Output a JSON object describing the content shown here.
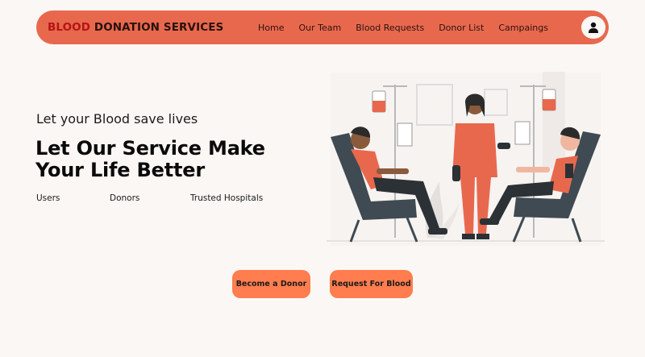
{
  "brand": {
    "part1": "BLOOD",
    "part2": "DONATION SERVICES"
  },
  "nav": {
    "items": [
      {
        "label": "Home"
      },
      {
        "label": "Our Team"
      },
      {
        "label": "Blood Requests"
      },
      {
        "label": "Donor List"
      },
      {
        "label": "Campaings"
      }
    ],
    "profile_icon": "user-avatar-icon"
  },
  "hero": {
    "tagline": "Let your Blood save lives",
    "headline": "Let Our Service Make Your Life Better",
    "stats": [
      {
        "label": "Users"
      },
      {
        "label": "Donors"
      },
      {
        "label": "Trusted Hospitals"
      }
    ],
    "illustration_icon": "blood-donation-illustration"
  },
  "actions": {
    "become_donor": "Become a Donor",
    "request_blood": "Request For Blood"
  },
  "colors": {
    "nav_bg": "#e8684e",
    "brand_accent": "#b51414",
    "button_bg": "#ff7d4e",
    "page_bg": "#faf7f4"
  }
}
